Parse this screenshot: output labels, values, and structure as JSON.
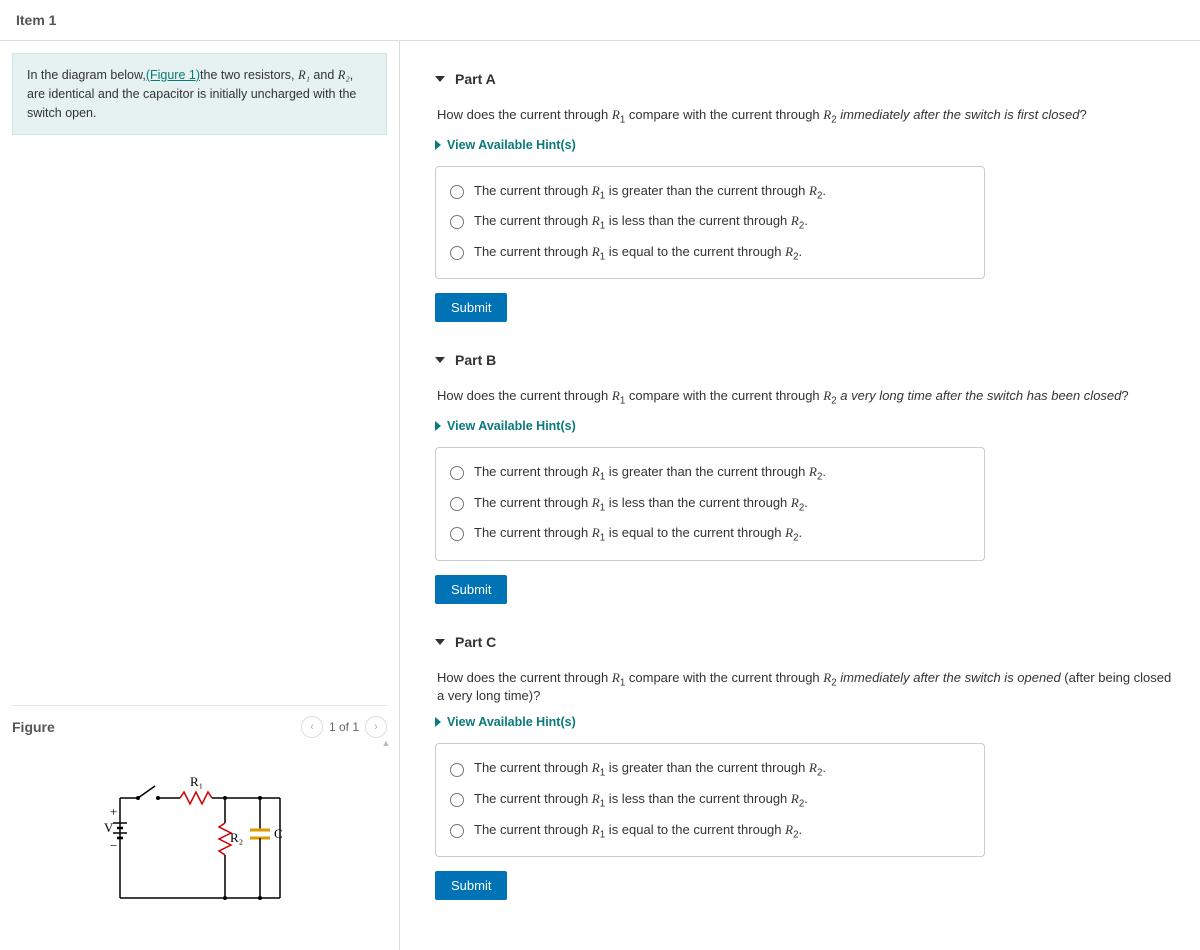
{
  "page_title": "Item 1",
  "problem": {
    "prefix": "In the diagram below,",
    "figure_link": "(Figure 1)",
    "text_after": "the two resistors, ",
    "r1": "R₁",
    "and": " and ",
    "r2": "R₂",
    "suffix": ", are identical and the capacitor is initially uncharged with the switch open."
  },
  "figure": {
    "title": "Figure",
    "pager": "1 of 1",
    "labels": {
      "V": "V",
      "R1": "R₁",
      "R2": "R₂",
      "C": "C",
      "plus": "+",
      "minus": "−"
    }
  },
  "hint_label": "View Available Hint(s)",
  "submit_label": "Submit",
  "parts": [
    {
      "title": "Part A",
      "question_pre": "How does the current through ",
      "question_mid1": " compare with the current through ",
      "question_tail_italic": "immediately after the switch is first closed",
      "question_end": "?",
      "options": [
        {
          "pre": "The current through ",
          "mid": " is greater than the current through ",
          "post": "."
        },
        {
          "pre": "The current through ",
          "mid": " is less than the current through ",
          "post": "."
        },
        {
          "pre": "The current through ",
          "mid": " is equal to the current through ",
          "post": "."
        }
      ]
    },
    {
      "title": "Part B",
      "question_pre": "How does the current through ",
      "question_mid1": " compare with the current through ",
      "question_tail_italic": "a very long time after the switch has been closed",
      "question_end": "?",
      "options": [
        {
          "pre": "The current through ",
          "mid": " is greater than the current through ",
          "post": "."
        },
        {
          "pre": "The current through ",
          "mid": " is less than the current through ",
          "post": "."
        },
        {
          "pre": "The current through ",
          "mid": " is equal to the current through ",
          "post": "."
        }
      ]
    },
    {
      "title": "Part C",
      "question_pre": "How does the current through ",
      "question_mid1": " compare with the current through ",
      "question_tail_italic": "immediately after the switch is opened",
      "question_tail_plain": " (after being closed a very long time)?",
      "options": [
        {
          "pre": "The current through ",
          "mid": " is greater than the current through ",
          "post": "."
        },
        {
          "pre": "The current through ",
          "mid": " is less than the current through ",
          "post": "."
        },
        {
          "pre": "The current through ",
          "mid": " is equal to the current through ",
          "post": "."
        }
      ]
    }
  ]
}
